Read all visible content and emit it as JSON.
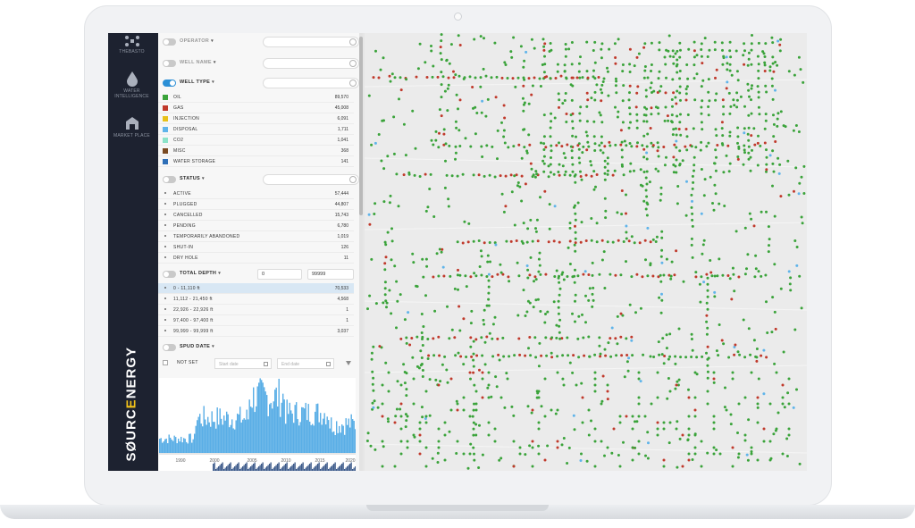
{
  "nav": {
    "items": [
      {
        "label": "THEBASTO",
        "icon": "network-icon"
      },
      {
        "label": "WATER INTELLIGENCE",
        "icon": "water-drop-icon"
      },
      {
        "label": "MARKET PLACE",
        "icon": "market-icon"
      }
    ],
    "brand": {
      "part1": "S",
      "part2": "Ø",
      "part3": "URC",
      "accent": "E",
      "part4": "NERGY"
    }
  },
  "filters": {
    "operator": {
      "label": "OPERATOR"
    },
    "well_name": {
      "label": "WELL NAME"
    },
    "well_type": {
      "label": "WELL TYPE",
      "items": [
        {
          "label": "OIL",
          "count": "89,570",
          "color": "#3aa33a"
        },
        {
          "label": "GAS",
          "count": "45,008",
          "color": "#c0392b"
        },
        {
          "label": "INJECTION",
          "count": "6,091",
          "color": "#e8c11a"
        },
        {
          "label": "DISPOSAL",
          "count": "1,711",
          "color": "#5fb4ea"
        },
        {
          "label": "CO2",
          "count": "1,041",
          "color": "#8de3c9"
        },
        {
          "label": "MISC",
          "count": "368",
          "color": "#7a4a22"
        },
        {
          "label": "WATER STORAGE",
          "count": "141",
          "color": "#2e6fb7"
        }
      ]
    },
    "status": {
      "label": "STATUS",
      "items": [
        {
          "label": "ACTIVE",
          "count": "57,444"
        },
        {
          "label": "PLUGGED",
          "count": "44,807"
        },
        {
          "label": "CANCELLED",
          "count": "15,743"
        },
        {
          "label": "PENDING",
          "count": "6,780"
        },
        {
          "label": "TEMPORARILY ABANDONED",
          "count": "1,019"
        },
        {
          "label": "SHUT-IN",
          "count": "126"
        },
        {
          "label": "DRY HOLE",
          "count": "11"
        }
      ]
    },
    "total_depth": {
      "label": "TOTAL DEPTH",
      "min": "0",
      "max": "99999",
      "items": [
        {
          "label": "0 - 11,110 ft",
          "count": "70,533"
        },
        {
          "label": "11,112 - 21,450 ft",
          "count": "4,568"
        },
        {
          "label": "22,926 - 22,926 ft",
          "count": "1"
        },
        {
          "label": "97,400 - 97,400 ft",
          "count": "1"
        },
        {
          "label": "99,999 - 99,999 ft",
          "count": "3,037"
        }
      ]
    },
    "spud_date": {
      "label": "SPUD DATE",
      "not_set": "NOT SET",
      "start_placeholder": "Start date",
      "end_placeholder": "End date"
    }
  },
  "histogram": {
    "x_ticks": [
      "1990",
      "2000",
      "2005",
      "2010",
      "2015",
      "2020"
    ],
    "bar_color": "#5aaee6"
  },
  "map": {
    "dot_colors": [
      "#3aa33a",
      "#c0392b",
      "#5fb4ea"
    ]
  }
}
